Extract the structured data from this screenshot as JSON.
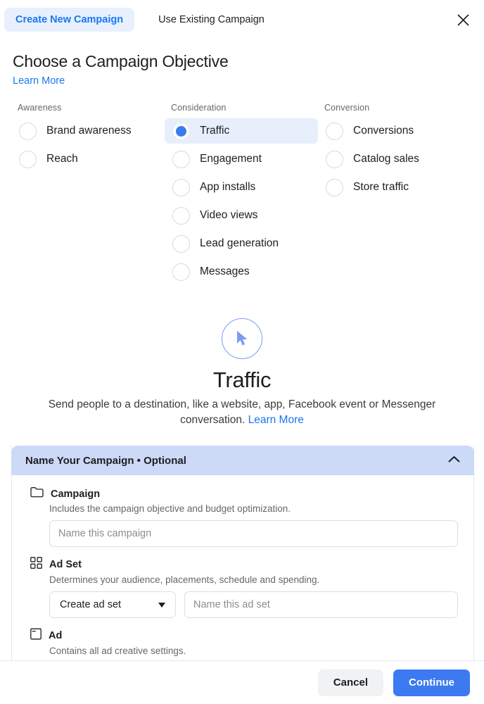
{
  "tabs": [
    {
      "label": "Create New Campaign",
      "active": true
    },
    {
      "label": "Use Existing Campaign",
      "active": false
    }
  ],
  "close_icon": "close-icon",
  "header": {
    "title": "Choose a Campaign Objective",
    "learn_more": "Learn More"
  },
  "objectives": {
    "columns": [
      {
        "heading": "Awareness",
        "options": [
          {
            "label": "Brand awareness",
            "selected": false
          },
          {
            "label": "Reach",
            "selected": false
          }
        ]
      },
      {
        "heading": "Consideration",
        "options": [
          {
            "label": "Traffic",
            "selected": true
          },
          {
            "label": "Engagement",
            "selected": false
          },
          {
            "label": "App installs",
            "selected": false
          },
          {
            "label": "Video views",
            "selected": false
          },
          {
            "label": "Lead generation",
            "selected": false
          },
          {
            "label": "Messages",
            "selected": false
          }
        ]
      },
      {
        "heading": "Conversion",
        "options": [
          {
            "label": "Conversions",
            "selected": false
          },
          {
            "label": "Catalog sales",
            "selected": false
          },
          {
            "label": "Store traffic",
            "selected": false
          }
        ]
      }
    ]
  },
  "hero": {
    "icon": "cursor-pointer-icon",
    "title": "Traffic",
    "description": "Send people to a destination, like a website, app, Facebook event or Messenger conversation. ",
    "learn_more": "Learn More"
  },
  "name_section": {
    "header_title": "Name Your Campaign • Optional",
    "collapse_icon": "chevron-up-icon",
    "blocks": [
      {
        "icon": "folder-icon",
        "title": "Campaign",
        "subtitle": "Includes the campaign objective and budget optimization.",
        "input_placeholder": "Name this campaign",
        "input_value": ""
      },
      {
        "icon": "grid-icon",
        "title": "Ad Set",
        "subtitle": "Determines your audience, placements, schedule and spending.",
        "select_value": "Create ad set",
        "input_placeholder": "Name this ad set",
        "input_value": ""
      },
      {
        "icon": "ad-window-icon",
        "title": "Ad",
        "subtitle": "Contains all ad creative settings.",
        "input_placeholder": "",
        "input_value": ""
      }
    ]
  },
  "footer": {
    "cancel_label": "Cancel",
    "continue_label": "Continue"
  },
  "colors": {
    "accent_blue": "#1877f2",
    "button_blue": "#3b7af0",
    "tab_active_bg": "#e8f0fe",
    "section_header_bg": "#ccd9f7",
    "selected_row_bg": "#e7eefc"
  }
}
